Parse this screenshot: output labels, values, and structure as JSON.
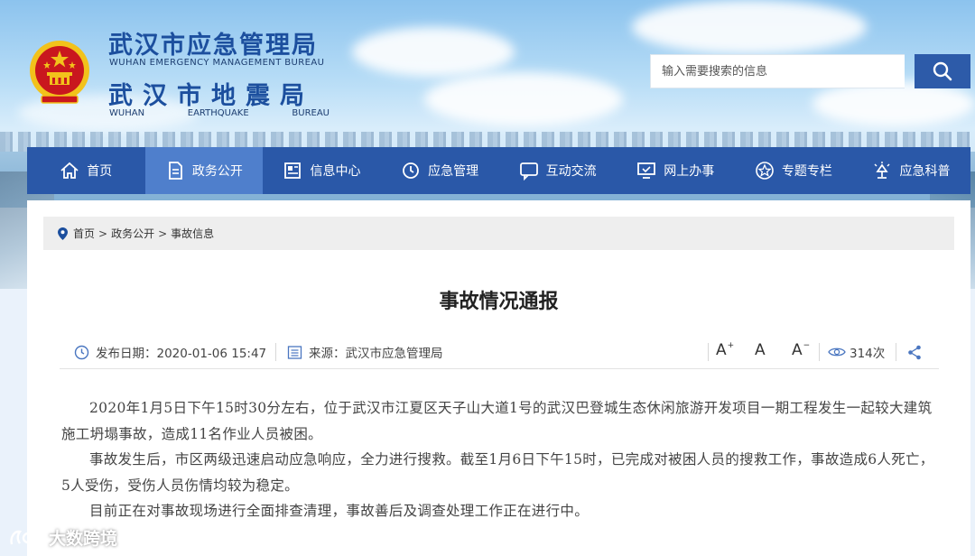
{
  "brand": {
    "name_cn_1": "武汉市应急管理局",
    "name_en_1": "WUHAN EMERGENCY MANAGEMENT BUREAU",
    "name_cn_2": "武汉市地震局",
    "name_en_2": [
      "WUHAN",
      "EARTHQUAKE",
      "BUREAU"
    ]
  },
  "search": {
    "placeholder": "输入需要搜索的信息",
    "icon": "search-icon"
  },
  "nav": {
    "active_index": 1,
    "items": [
      {
        "label": "首页",
        "icon": "home-icon"
      },
      {
        "label": "政务公开",
        "icon": "document-icon"
      },
      {
        "label": "信息中心",
        "icon": "news-icon"
      },
      {
        "label": "应急管理",
        "icon": "clock-icon"
      },
      {
        "label": "互动交流",
        "icon": "chat-icon"
      },
      {
        "label": "网上办事",
        "icon": "monitor-icon"
      },
      {
        "label": "专题专栏",
        "icon": "star-icon"
      },
      {
        "label": "应急科普",
        "icon": "lamp-icon"
      }
    ]
  },
  "breadcrumb": [
    "首页",
    "政务公开",
    "事故信息"
  ],
  "article": {
    "title": "事故情况通报",
    "publish_label": "发布日期：2020-01-06 15:47",
    "source_label": "来源：武汉市应急管理局",
    "font_controls": [
      "A",
      "A",
      "A"
    ],
    "views_label": "314次",
    "paragraphs": [
      "2020年1月5日下午15时30分左右，位于武汉市江夏区天子山大道1号的武汉巴登城生态休闲旅游开发项目一期工程发生一起较大建筑施工坍塌事故，造成11名作业人员被困。",
      "事故发生后，市区两级迅速启动应急响应，全力进行搜救。截至1月6日下午15时，已完成对被困人员的搜救工作，事故造成6人死亡，5人受伤，受伤人员伤情均较为稳定。",
      "目前正在对事故现场进行全面排查清理，事故善后及调查处理工作正在进行中。"
    ]
  },
  "watermark": "大数跨境",
  "colors": {
    "nav_bg": "#2a58a8",
    "nav_active": "#4f7fcc",
    "brand_blue": "#1c4f9e",
    "emblem_red": "#c9171e",
    "emblem_gold": "#f2c21b"
  }
}
